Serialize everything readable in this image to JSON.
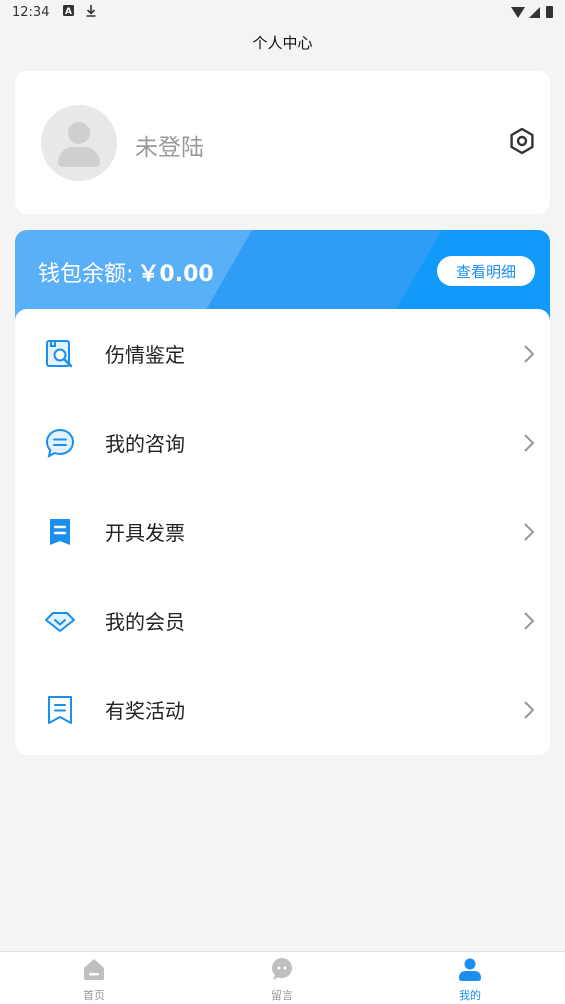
{
  "status_bar": {
    "time": "12:34",
    "icons": [
      "a-icon",
      "download-icon",
      "wifi-icon",
      "cell-signal-icon",
      "battery-icon"
    ]
  },
  "header": {
    "title": "个人中心"
  },
  "profile": {
    "login_status": "未登陆",
    "avatar_icon": "user-placeholder-icon",
    "settings_icon": "settings-hexagon-icon"
  },
  "wallet": {
    "label": "钱包余额:",
    "amount": "￥0.00",
    "detail_button": "查看明细"
  },
  "menu": {
    "items": [
      {
        "label": "伤情鉴定",
        "icon": "document-search-icon"
      },
      {
        "label": "我的咨询",
        "icon": "chat-bubble-icon"
      },
      {
        "label": "开具发票",
        "icon": "receipt-icon"
      },
      {
        "label": "我的会员",
        "icon": "diamond-icon"
      },
      {
        "label": "有奖活动",
        "icon": "bookmark-icon"
      }
    ]
  },
  "tab_bar": {
    "tabs": [
      {
        "label": "首页",
        "icon": "home-icon",
        "active": false
      },
      {
        "label": "留言",
        "icon": "message-icon",
        "active": false
      },
      {
        "label": "我的",
        "icon": "profile-icon",
        "active": true
      }
    ]
  },
  "colors": {
    "accent": "#1a8ff0",
    "page_bg": "#f4f4f4",
    "wallet_light": "#5ab0f7",
    "wallet_dark": "#129afa",
    "inactive": "#999999"
  }
}
